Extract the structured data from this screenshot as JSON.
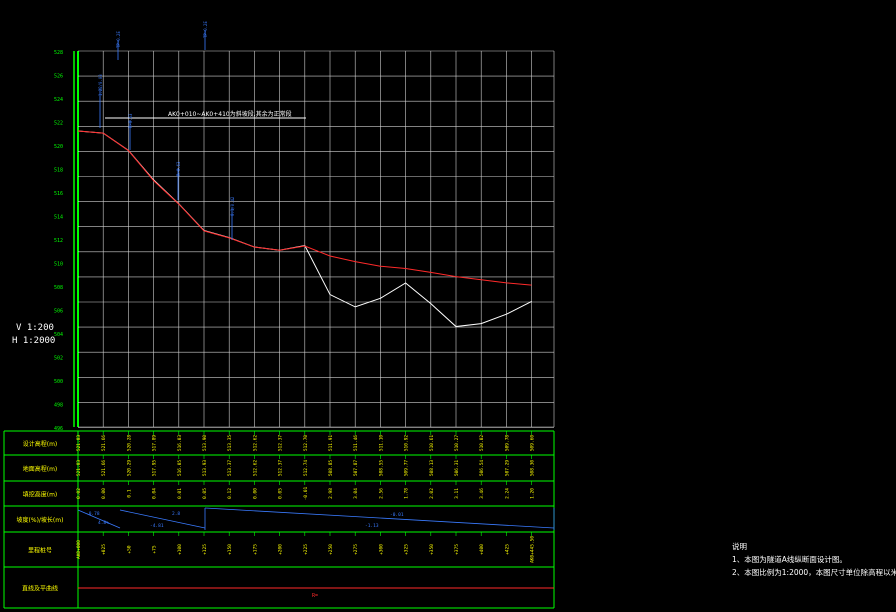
{
  "scale": {
    "vertical": "V 1:200",
    "horizontal": "H 1:2000"
  },
  "design_note": "AK0+010~AK0+410为斜坡段,其余为正常段",
  "y_axis_ticks": [
    "528",
    "526",
    "524",
    "522",
    "520",
    "518",
    "516",
    "514",
    "512",
    "510",
    "508",
    "506",
    "504",
    "502",
    "500",
    "498",
    "496"
  ],
  "row_titles": {
    "design": "设计高程(m)",
    "ground": "地面高程(m)",
    "fill_cut": "填挖高度(m)",
    "slope": "坡度(%)/坡长(m)",
    "station": "里程桩号",
    "curve": "直线及平曲线"
  },
  "design_row": [
    "521.83",
    "521.66",
    "520.28",
    "517.89",
    "516.03",
    "513.90",
    "513.35",
    "512.62",
    "512.37",
    "512.70",
    "511.91",
    "511.46",
    "511.10",
    "510.92",
    "510.61",
    "510.27",
    "510.02",
    "509.78",
    "509.60"
  ],
  "ground_row": [
    "521.83",
    "521.66",
    "520.29",
    "517.95",
    "516.05",
    "513.93",
    "513.37",
    "512.62",
    "512.37",
    "512.74",
    "508.85",
    "507.87",
    "508.55",
    "509.77",
    "508.13",
    "506.31",
    "506.54",
    "507.29",
    "508.30"
  ],
  "fill_row": [
    "0.02",
    "0.00",
    "0.1",
    "0.04",
    "0.01",
    "0.05",
    "0.12",
    "0.00",
    "0.05",
    "-0.01",
    "2.98",
    "3.04",
    "2.56",
    "1.78",
    "2.02",
    "3.11",
    "3.46",
    "2.24",
    "1.20"
  ],
  "station_row": [
    "AK0+000",
    "+025",
    "+50",
    "+75",
    "+100",
    "+125",
    "+150",
    "+175",
    "+200",
    "+225",
    "+250",
    "+275",
    "+300",
    "+325",
    "+350",
    "+375",
    "+400",
    "+425",
    "AK0+445.50"
  ],
  "slope_labels": [
    "-0.78",
    "4.8%",
    "-4.81",
    "2.8",
    "-0.01",
    "-1.13"
  ],
  "markers": {
    "top_mark": "TP-0.2E",
    "left_marks": "1.22/0.03",
    "mid_mark": "R-0.63",
    "right_mark": "0.1/0.42"
  },
  "curve_label": "R=",
  "notes": {
    "title": "说明",
    "line1": "1、本图为隧道A线纵断面设计图。",
    "line2": "2、本图比例为1:2000，本图尺寸单位除高程以米计。"
  },
  "colors": {
    "grid": "#ffffff",
    "frame": "#00ff00",
    "design_line": "#ff2a2a",
    "ground_line": "#ffffff",
    "values": "#ffff00",
    "dim": "#3a7bff"
  }
}
